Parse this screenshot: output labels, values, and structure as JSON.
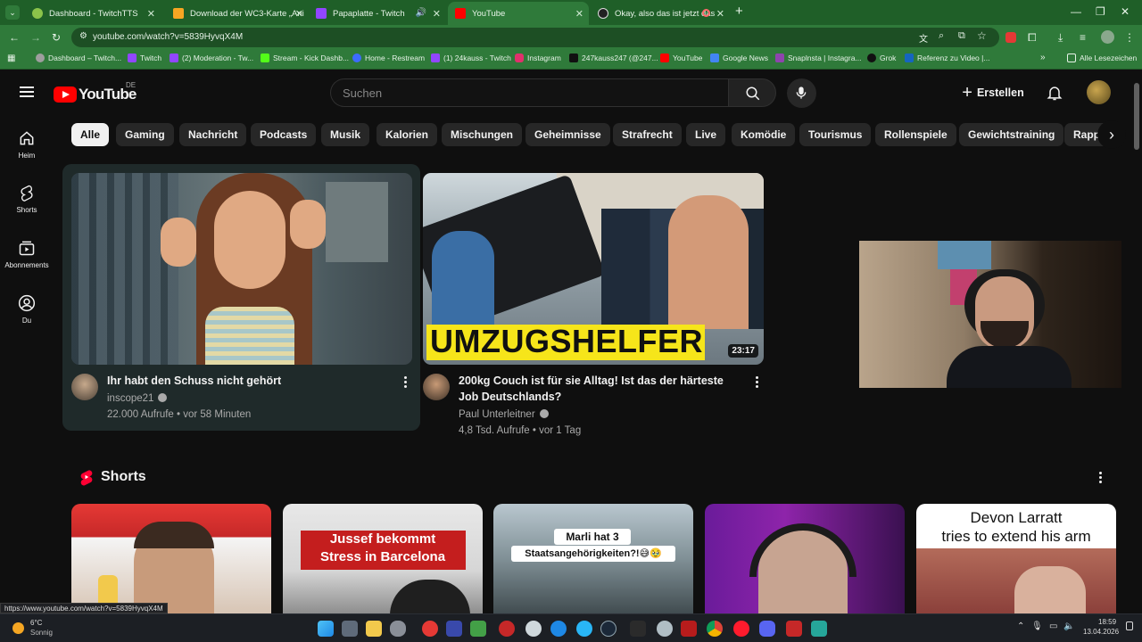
{
  "browser": {
    "tabs": [
      {
        "label": "Dashboard - TwitchTTS",
        "color": "#8bc34a"
      },
      {
        "label": "Download der WC3-Karte „Ani",
        "color": "#f6a623"
      },
      {
        "label": "Papaplatte - Twitch",
        "color": "#9146ff"
      },
      {
        "label": "YouTube",
        "color": "#ff0000"
      },
      {
        "label": "Okay, also das ist jetzt das",
        "color": "#222222"
      }
    ],
    "url": "youtube.com/watch?v=5839HyvqX4M",
    "bookmarks": [
      "Dashboard – Twitch...",
      "Twitch",
      "(2) Moderation - Tw...",
      "Stream - Kick Dashb...",
      "Home - Restream",
      "(1) 24kauss - Twitch",
      "Instagram",
      "247kauss247 (@247...",
      "YouTube",
      "Google News",
      "Snaplnsta | Instagra...",
      "Grok",
      "Referenz zu Video |..."
    ],
    "all_bookmarks": "Alle Lesezeichen"
  },
  "youtube": {
    "logo_text": "YouTube",
    "country": "DE",
    "search_placeholder": "Suchen",
    "create_label": "Erstellen",
    "sidebar": [
      "Heim",
      "Shorts",
      "Abonnements",
      "Du"
    ],
    "chips": [
      "Alle",
      "Gaming",
      "Nachricht",
      "Podcasts",
      "Musik",
      "Kalorien",
      "Mischungen",
      "Geheimnisse",
      "Strafrecht",
      "Live",
      "Komödie",
      "Tourismus",
      "Rollenspiele",
      "Gewichtstraining",
      "Rappe"
    ],
    "videos": [
      {
        "title": "Ihr habt den Schuss nicht gehört",
        "channel": "inscope21",
        "meta": "22.000 Aufrufe • vor 58 Minuten"
      },
      {
        "title_line1": "200kg Couch ist für sie Alltag! Ist das der härteste",
        "title_line2": "Job Deutschlands?",
        "channel": "Paul Unterleitner",
        "meta": "4,8 Tsd. Aufrufe • vor 1 Tag",
        "duration": "23:17",
        "thumb_text": "UMZUGSHELFER"
      }
    ],
    "shorts_heading": "Shorts",
    "shorts": [
      {
        "overlay": ""
      },
      {
        "overlay_line1": "Jussef bekommt",
        "overlay_line2": "Stress in Barcelona"
      },
      {
        "overlay_line1": "Marli hat 3",
        "overlay_line2": "Staatsangehörigkeiten?!😅🥹"
      },
      {
        "overlay": ""
      },
      {
        "overlay_line1": "Devon Larratt",
        "overlay_line2": "tries to extend his arm"
      }
    ]
  },
  "status_url": "https://www.youtube.com/watch?v=5839HyvqX4M",
  "taskbar": {
    "weather_temp": "6°C",
    "weather_desc": "Sonnig",
    "time": "18:59",
    "date": "13.04.2026"
  }
}
